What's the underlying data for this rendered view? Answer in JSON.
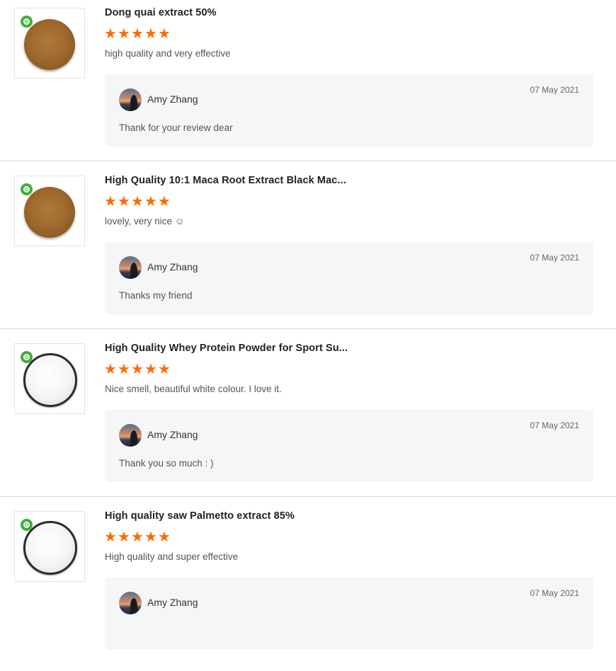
{
  "reviews": [
    {
      "product": "Dong quai extract 50%",
      "rating": 5,
      "comment": "high quality and very effective",
      "powder": "brown",
      "reply": {
        "author": "Amy Zhang",
        "date": "07 May 2021",
        "text": "Thank for your review dear"
      }
    },
    {
      "product": "High Quality 10:1 Maca Root Extract Black Mac...",
      "rating": 5,
      "comment": "lovely, very nice ☺",
      "powder": "brown",
      "reply": {
        "author": "Amy Zhang",
        "date": "07 May 2021",
        "text": "Thanks my friend"
      }
    },
    {
      "product": "High Quality Whey Protein Powder for Sport Su...",
      "rating": 5,
      "comment": "Nice smell, beautiful white colour. I love it.",
      "powder": "white",
      "reply": {
        "author": "Amy Zhang",
        "date": "07 May 2021",
        "text": "Thank you so much : )"
      }
    },
    {
      "product": "High quality saw Palmetto extract 85%",
      "rating": 5,
      "comment": "High quality and super effective",
      "powder": "white",
      "reply": {
        "author": "Amy Zhang",
        "date": "07 May 2021",
        "text": ""
      }
    }
  ],
  "colors": {
    "star": "#ff6a00",
    "badge": "#3fae3a",
    "reply_bg": "#f5f6f8"
  },
  "icons": {
    "star": "star-icon",
    "badge": "verified-badge-icon",
    "avatar": "avatar"
  }
}
